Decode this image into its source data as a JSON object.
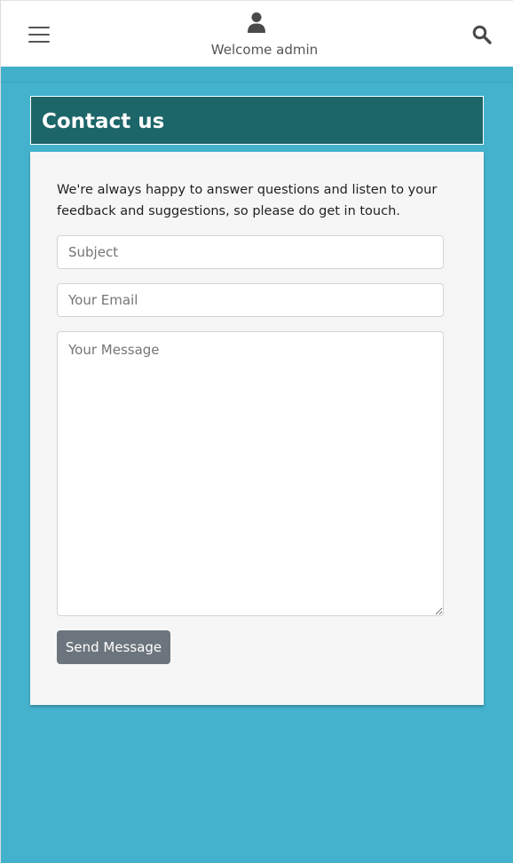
{
  "header": {
    "welcome_text": "Welcome admin",
    "menu_icon": "hamburger-menu-icon",
    "user_icon": "user-icon",
    "search_icon": "search-icon"
  },
  "page": {
    "title": "Contact us"
  },
  "contact_form": {
    "intro_text": "We're always happy to answer questions and listen to your feedback and suggestions, so please do get in touch.",
    "subject_placeholder": "Subject",
    "email_placeholder": "Your Email",
    "message_placeholder": "Your Message",
    "send_label": "Send Message"
  },
  "colors": {
    "page_background": "#44b2cd",
    "title_banner": "#1c6568",
    "send_button": "#6c757d",
    "card_background": "#f6f6f6"
  }
}
